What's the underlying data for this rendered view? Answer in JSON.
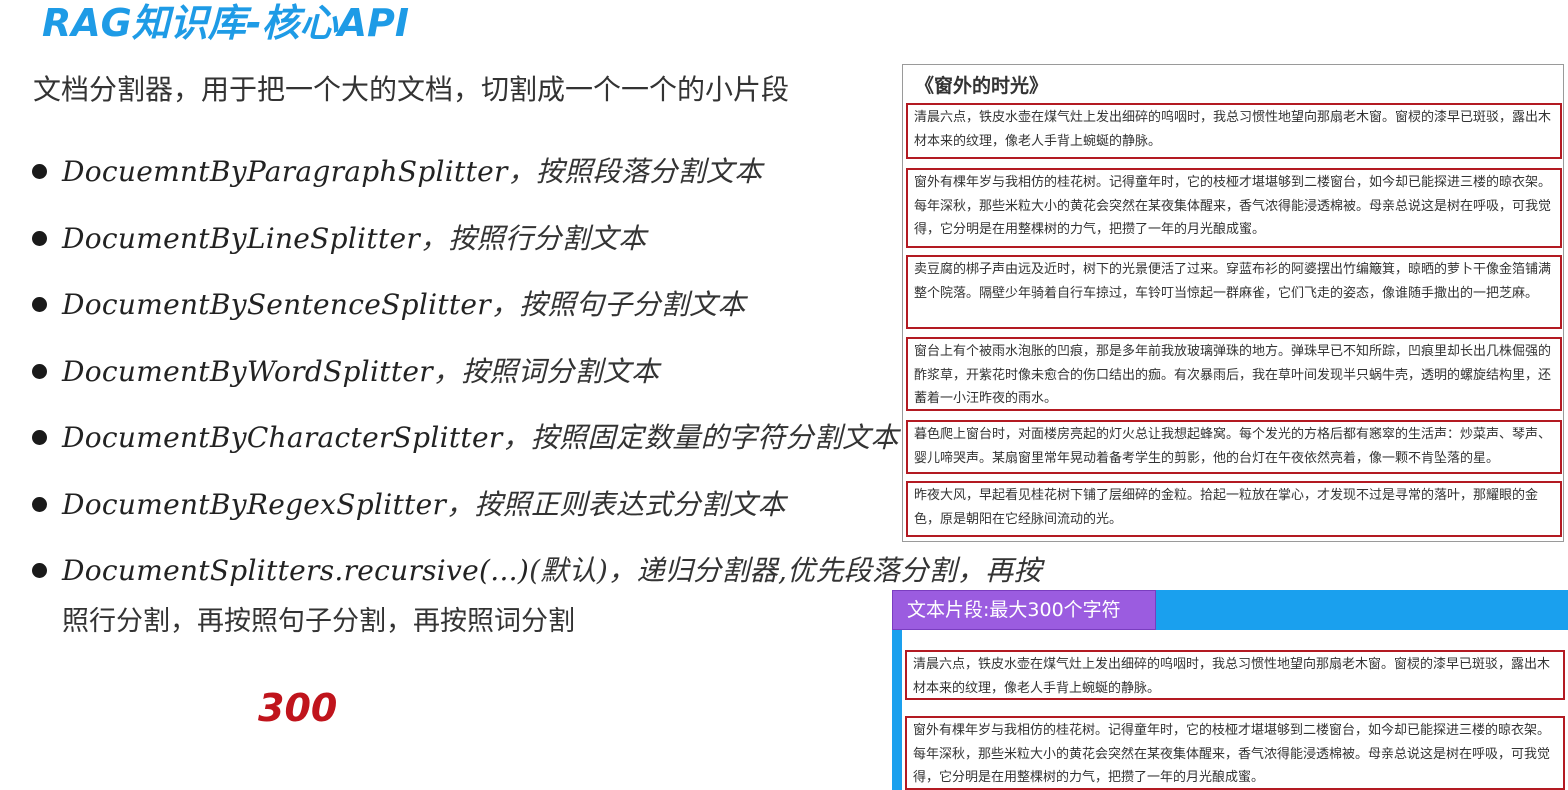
{
  "title": "RAG知识库-核心API",
  "intro": "文档分割器，用于把一个大的文档，切割成一个一个的小片段",
  "splitters": [
    {
      "code": "DocuemntByParagraphSplitter",
      "desc": "，按照段落分割文本"
    },
    {
      "code": "DocumentByLineSplitter",
      "desc": "，按照行分割文本"
    },
    {
      "code": "DocumentBySentenceSplitter",
      "desc": "，按照句子分割文本"
    },
    {
      "code": "DocumentByWordSplitter",
      "desc": "，按照词分割文本"
    },
    {
      "code": "DocumentByCharacterSplitter",
      "desc": "，按照固定数量的字符分割文本"
    },
    {
      "code": "DocumentByRegexSplitter",
      "desc": "，按照正则表达式分割文本"
    },
    {
      "code": "DocumentSplitters.recursive(...)",
      "desc": "(默认)，递归分割器,优先段落分割，再按",
      "desc_cont": "照行分割，再按照句子分割，再按照词分割"
    }
  ],
  "limit_mark": "300",
  "document": {
    "title": "《窗外的时光》",
    "paragraphs": [
      "清晨六点，铁皮水壶在煤气灶上发出细碎的呜咽时，我总习惯性地望向那扇老木窗。窗棂的漆早已斑驳，露出木材本来的纹理，像老人手背上蜿蜒的静脉。",
      "窗外有棵年岁与我相仿的桂花树。记得童年时，它的枝桠才堪堪够到二楼窗台，如今却已能探进三楼的晾衣架。每年深秋，那些米粒大小的黄花会突然在某夜集体醒来，香气浓得能浸透棉被。母亲总说这是树在呼吸，可我觉得，它分明是在用整棵树的力气，把攒了一年的月光酿成蜜。",
      "卖豆腐的梆子声由远及近时，树下的光景便活了过来。穿蓝布衫的阿婆摆出竹编簸箕，晾晒的萝卜干像金箔铺满整个院落。隔壁少年骑着自行车掠过，车铃叮当惊起一群麻雀，它们飞走的姿态，像谁随手撒出的一把芝麻。",
      "窗台上有个被雨水泡胀的凹痕，那是多年前我放玻璃弹珠的地方。弹珠早已不知所踪，凹痕里却长出几株倔强的酢浆草，开紫花时像未愈合的伤口结出的痂。有次暴雨后，我在草叶间发现半只蜗牛壳，透明的螺旋结构里，还蓄着一小汪昨夜的雨水。",
      "暮色爬上窗台时，对面楼房亮起的灯火总让我想起蜂窝。每个发光的方格后都有窸窣的生活声：炒菜声、琴声、婴儿啼哭声。某扇窗里常年晃动着备考学生的剪影，他的台灯在午夜依然亮着，像一颗不肯坠落的星。",
      "昨夜大风，早起看见桂花树下铺了层细碎的金粒。拾起一粒放在掌心，才发现不过是寻常的落叶，那耀眼的金色，原是朝阳在它经脉间流动的光。"
    ]
  },
  "segments": {
    "tab_label": "文本片段:最大300个字符",
    "items": [
      "清晨六点，铁皮水壶在煤气灶上发出细碎的呜咽时，我总习惯性地望向那扇老木窗。窗棂的漆早已斑驳，露出木材本来的纹理，像老人手背上蜿蜒的静脉。",
      "窗外有棵年岁与我相仿的桂花树。记得童年时，它的枝桠才堪堪够到二楼窗台，如今却已能探进三楼的晾衣架。每年深秋，那些米粒大小的黄花会突然在某夜集体醒来，香气浓得能浸透棉被。母亲总说这是树在呼吸，可我觉得，它分明是在用整棵树的力气，把攒了一年的月光酿成蜜。"
    ]
  },
  "colors": {
    "title": "#1e9be6",
    "limit_mark": "#c0141c",
    "para_border": "#b31a22",
    "segment_panel": "#1aa0ee",
    "segment_tab": "#9b5ce0"
  }
}
